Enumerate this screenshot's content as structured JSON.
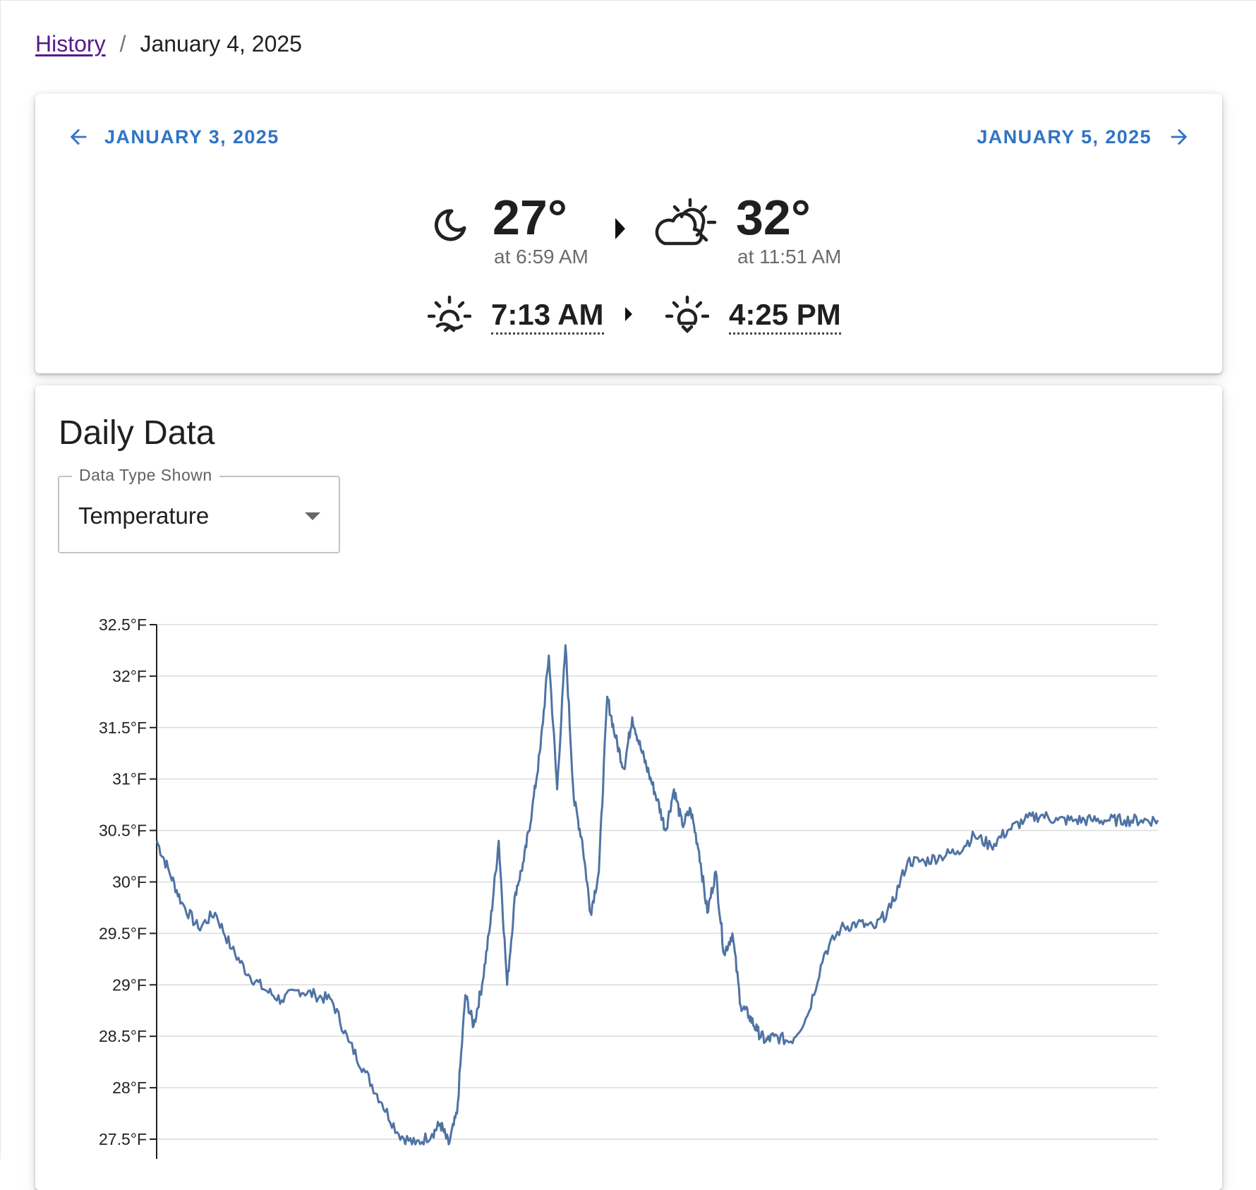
{
  "breadcrumb": {
    "parent": "History",
    "separator": "/",
    "current": "January 4, 2025"
  },
  "summary": {
    "prev_day": "JANUARY 3, 2025",
    "next_day": "JANUARY 5, 2025",
    "low": {
      "temp": "27°",
      "time": "at 6:59 AM",
      "icon": "moon-icon"
    },
    "high": {
      "temp": "32°",
      "time": "at 11:51 AM",
      "icon": "partly-cloudy-day-icon"
    },
    "sunrise": {
      "time": "7:13 AM",
      "icon": "sunrise-icon"
    },
    "sunset": {
      "time": "4:25 PM",
      "icon": "sunset-icon"
    },
    "accent_color": "#2f74c6"
  },
  "daily": {
    "title": "Daily Data",
    "select_label": "Data Type Shown",
    "select_value": "Temperature"
  },
  "chart_data": {
    "type": "line",
    "title": "",
    "xlabel": "",
    "ylabel": "",
    "y_unit": "°F",
    "ylim": [
      27.3,
      32.5
    ],
    "y_ticks": [
      "27.5°F",
      "28°F",
      "28.5°F",
      "29°F",
      "29.5°F",
      "30°F",
      "30.5°F",
      "31°F",
      "31.5°F",
      "32°F",
      "32.5°F"
    ],
    "y_tick_values": [
      27.5,
      28,
      28.5,
      29,
      29.5,
      30,
      30.5,
      31,
      31.5,
      32,
      32.5
    ],
    "grid": true,
    "color": "#4f73a3",
    "series": [
      {
        "x": [
          0,
          0.3,
          0.6,
          1.0,
          1.4,
          1.8,
          2.2,
          2.6,
          3.0,
          3.4,
          3.8,
          4.2,
          4.6,
          5.0,
          5.4,
          5.8,
          6.2,
          6.6,
          6.8,
          7.0,
          7.2,
          7.4,
          7.6,
          7.8,
          8.0,
          8.2,
          8.4,
          8.6,
          8.8,
          9.0,
          9.2,
          9.4,
          9.6,
          9.8,
          10.0,
          10.2,
          10.4,
          10.6,
          10.8,
          11.0,
          11.2,
          11.4,
          11.6,
          11.8,
          12.0,
          12.2,
          12.4,
          12.6,
          12.8,
          13.0,
          13.2,
          13.4,
          13.6,
          13.8,
          14.0,
          14.2,
          14.4,
          14.6,
          14.8,
          15.2,
          15.6,
          16.0,
          16.4,
          16.8,
          17.2,
          17.6,
          18.0,
          18.4,
          18.8,
          19.2,
          19.6,
          20.0,
          20.4,
          20.8,
          21.2,
          21.6,
          22.0,
          22.4,
          22.8,
          23.2,
          23.6,
          24.0
        ],
        "y": [
          30.4,
          30.1,
          29.8,
          29.55,
          29.7,
          29.35,
          29.1,
          28.95,
          28.85,
          28.95,
          28.9,
          28.85,
          28.45,
          28.15,
          27.85,
          27.55,
          27.45,
          27.55,
          27.65,
          27.45,
          27.75,
          28.9,
          28.6,
          29.0,
          29.6,
          30.4,
          29.0,
          29.9,
          30.2,
          30.7,
          31.3,
          32.2,
          30.9,
          32.3,
          30.8,
          30.4,
          29.7,
          30.1,
          31.8,
          31.4,
          31.1,
          31.6,
          31.3,
          31.05,
          30.8,
          30.5,
          30.9,
          30.55,
          30.7,
          30.3,
          29.7,
          30.1,
          29.3,
          29.5,
          28.8,
          28.7,
          28.55,
          28.45,
          28.5,
          28.45,
          28.7,
          29.3,
          29.55,
          29.6,
          29.55,
          29.75,
          30.2,
          30.2,
          30.25,
          30.3,
          30.45,
          30.35,
          30.5,
          30.6,
          30.65,
          30.6,
          30.6,
          30.6,
          30.6,
          30.6,
          30.6,
          30.6
        ]
      }
    ]
  }
}
